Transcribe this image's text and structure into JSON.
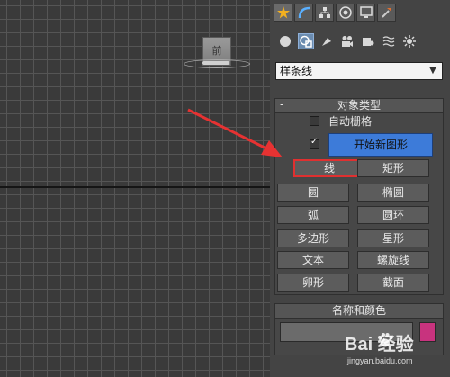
{
  "viewport": {
    "viewcube_label": "前"
  },
  "command_panel": {
    "top_tabs": [
      {
        "icon": "create-icon",
        "active": true
      },
      {
        "icon": "modify-icon",
        "active": false
      },
      {
        "icon": "hierarchy-icon",
        "active": false
      },
      {
        "icon": "motion-icon",
        "active": false
      },
      {
        "icon": "display-icon",
        "active": false
      },
      {
        "icon": "utilities-icon",
        "active": false
      }
    ],
    "sub_categories": [
      {
        "icon": "geometry-icon",
        "active": false
      },
      {
        "icon": "shapes-icon",
        "active": true
      },
      {
        "icon": "lights-icon",
        "active": false
      },
      {
        "icon": "cameras-icon",
        "active": false
      },
      {
        "icon": "helpers-icon",
        "active": false
      },
      {
        "icon": "space-warps-icon",
        "active": false
      },
      {
        "icon": "systems-icon",
        "active": false
      }
    ],
    "category_select": {
      "value": "样条线"
    },
    "object_type": {
      "title": "对象类型",
      "collapse": "-",
      "autogrid_label": "自动栅格",
      "autogrid_checked": false,
      "start_new_shape_checked": true,
      "start_new_shape_label": "开始新图形",
      "buttons": {
        "line": "线",
        "rectangle": "矩形",
        "circle": "圆",
        "ellipse": "椭圆",
        "arc": "弧",
        "donut": "圆环",
        "ngon": "多边形",
        "star": "星形",
        "text": "文本",
        "helix": "螺旋线",
        "egg": "卵形",
        "section": "截面"
      }
    },
    "name_and_color": {
      "title": "名称和颜色",
      "collapse": "-",
      "name_value": "",
      "swatch_color": "#c8337e"
    }
  },
  "annotation": {
    "color": "#e63232",
    "highlight_target": "line"
  },
  "watermark": {
    "logo": "Bai  经验",
    "url": "jingyan.baidu.com"
  }
}
